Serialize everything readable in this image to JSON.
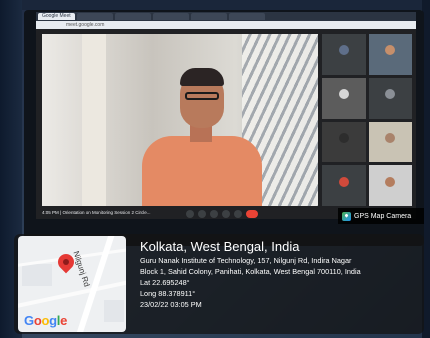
{
  "scene": {
    "browser_tabs": [
      "Google Meet",
      "",
      "",
      "",
      "",
      "",
      ""
    ],
    "url": "meet.google.com",
    "meeting_time_label": "4:05 PM",
    "meeting_name": "Orientation on Monitoring Session 2 Circle...",
    "participant_tiles": [
      "",
      "",
      "",
      "",
      "",
      "",
      "",
      ""
    ]
  },
  "gps_camera": {
    "app_name": "GPS Map Camera",
    "map_road_label": "Nilgunj Rd",
    "map_brand": "Google",
    "location_title": "Kolkata, West Bengal, India",
    "address_line1": "Guru Nanak Institute of Technology, 157, Nilgunj Rd, Indira Nagar",
    "address_line2": "Block 1, Sahid Colony, Panihati, Kolkata, West Bengal 700110, India",
    "latitude": "Lat 22.695248°",
    "longitude": "Long 88.378911°",
    "datetime": "23/02/22 03:05 PM"
  },
  "colors": {
    "pin": "#e53935",
    "overlay": "#141414",
    "meet_background": "#202124"
  }
}
